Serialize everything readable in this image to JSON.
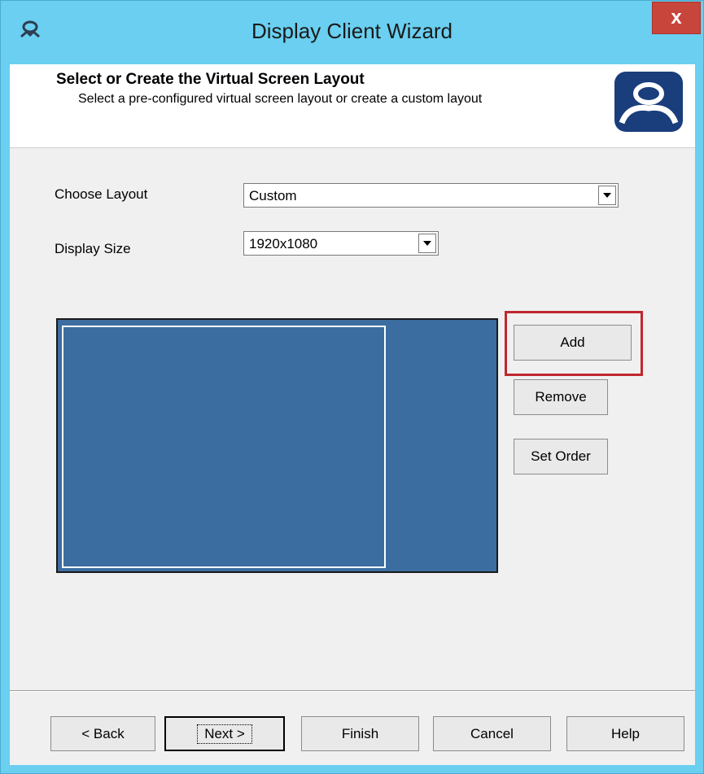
{
  "window": {
    "title": "Display Client Wizard",
    "close_label": "x",
    "accent": "#6acff0",
    "close_color": "#c8453c"
  },
  "header": {
    "title": "Select or Create the Virtual Screen Layout",
    "subtitle": "Select a pre-configured virtual screen layout or create a custom layout",
    "logo_icon": "thinmanager-logo-icon"
  },
  "form": {
    "layout_label": "Choose Layout",
    "layout_value": "Custom",
    "size_label": "Display Size",
    "size_value": "1920x1080"
  },
  "canvas": {
    "background": "#3c6da0"
  },
  "actions": {
    "add": "Add",
    "remove": "Remove",
    "set_order": "Set Order"
  },
  "footer": {
    "back": "< Back",
    "next": "Next >",
    "finish": "Finish",
    "cancel": "Cancel",
    "help": "Help"
  }
}
